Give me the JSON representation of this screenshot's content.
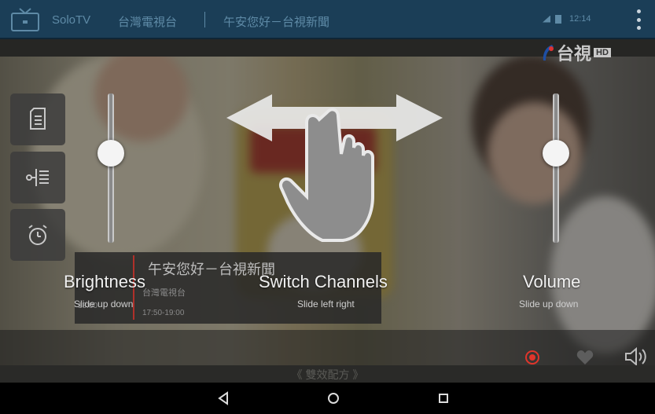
{
  "topbar": {
    "app_name": "SoloTV",
    "channel_name": "台灣電視台",
    "program_title": "午安您好－台視新聞",
    "clock": "12:14",
    "bar_color": "#1b3e57"
  },
  "logo": {
    "text": "台視",
    "badge": "HD"
  },
  "side_buttons": [
    {
      "icon": "program-list-icon"
    },
    {
      "icon": "channel-list-icon"
    },
    {
      "icon": "alarm-clock-icon"
    }
  ],
  "sliders": {
    "brightness_level": 0.62,
    "volume_level": 0.62
  },
  "epg": {
    "title": "午安您好－台視新聞",
    "channel": "台灣電視台",
    "time": "17:50-19:00",
    "left_text": "18:00"
  },
  "hints": {
    "brightness": {
      "label": "Brightness",
      "sub": "Slide up down"
    },
    "channels": {
      "label": "Switch Channels",
      "sub": "Slide left right"
    },
    "volume": {
      "label": "Volume",
      "sub": "Slide up down"
    }
  },
  "player": {
    "subtitle": "《 雙效配方 》",
    "accent": "#e0352b"
  },
  "navbar": {
    "back": "back-icon",
    "home": "home-icon",
    "recents": "recents-icon"
  }
}
